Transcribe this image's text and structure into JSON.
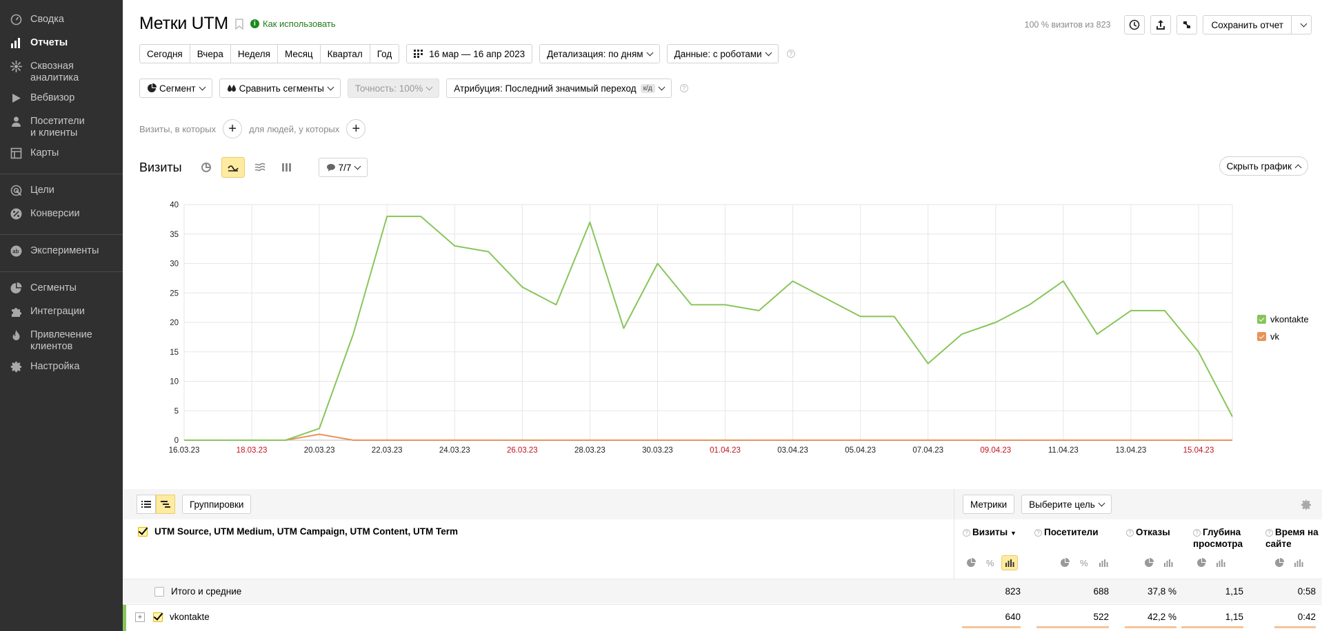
{
  "sidebar": {
    "items": [
      {
        "label": "Сводка",
        "icon": "dashboard-icon",
        "active": false
      },
      {
        "label": "Отчеты",
        "icon": "reports-icon",
        "active": true
      },
      {
        "label": "Сквозная\nаналитика",
        "icon": "crm-analytics-icon",
        "active": false
      },
      {
        "label": "Вебвизор",
        "icon": "play-icon",
        "active": false
      },
      {
        "label": "Посетители\nи клиенты",
        "icon": "person-icon",
        "active": false
      },
      {
        "label": "Карты",
        "icon": "maps-icon",
        "active": false
      },
      {
        "label": "Цели",
        "icon": "goals-icon",
        "active": false
      },
      {
        "label": "Конверсии",
        "icon": "percent-icon",
        "active": false
      },
      {
        "label": "Эксперименты",
        "icon": "ab-icon",
        "active": false
      },
      {
        "label": "Сегменты",
        "icon": "segments-icon",
        "active": false
      },
      {
        "label": "Интеграции",
        "icon": "puzzle-icon",
        "active": false
      },
      {
        "label": "Привлечение\nклиентов",
        "icon": "flame-icon",
        "active": false
      },
      {
        "label": "Настройка",
        "icon": "gear-icon",
        "active": false
      }
    ]
  },
  "header": {
    "title": "Метки UTM",
    "howto_label": "Как использовать",
    "visits_of": "100 % визитов из 823",
    "save_label": "Сохранить отчет"
  },
  "period": {
    "options": [
      "Сегодня",
      "Вчера",
      "Неделя",
      "Месяц",
      "Квартал",
      "Год"
    ],
    "date_range": "16 мар — 16 апр 2023",
    "detail": "Детализация: по дням",
    "data": "Данные: с роботами"
  },
  "filters": {
    "segment": "Сегмент",
    "compare": "Сравнить сегменты",
    "accuracy": "Точность: 100%",
    "attribution": "Атрибуция: Последний значимый переход",
    "attribution_badge": "к/д"
  },
  "conditions": {
    "visits_where": "Визиты, в которых",
    "people_where": "для людей, у которых"
  },
  "chart_head": {
    "title": "Визиты",
    "counter": "7/7",
    "hide_label": "Скрыть график"
  },
  "chart_data": {
    "type": "line",
    "x": [
      "16.03.23",
      "17.03.23",
      "18.03.23",
      "19.03.23",
      "20.03.23",
      "21.03.23",
      "22.03.23",
      "23.03.23",
      "24.03.23",
      "25.03.23",
      "26.03.23",
      "27.03.23",
      "28.03.23",
      "29.03.23",
      "30.03.23",
      "31.03.23",
      "01.04.23",
      "02.04.23",
      "03.04.23",
      "04.04.23",
      "05.04.23",
      "06.04.23",
      "07.04.23",
      "08.04.23",
      "09.04.23",
      "10.04.23",
      "11.04.23",
      "12.04.23",
      "13.04.23",
      "14.04.23",
      "15.04.23",
      "16.04.23"
    ],
    "tick_labels": [
      "16.03.23",
      "18.03.23",
      "20.03.23",
      "22.03.23",
      "24.03.23",
      "26.03.23",
      "28.03.23",
      "30.03.23",
      "01.04.23",
      "03.04.23",
      "05.04.23",
      "07.04.23",
      "09.04.23",
      "11.04.23",
      "13.04.23",
      "15.04.23"
    ],
    "weekend_ticks": [
      "18.03.23",
      "26.03.23",
      "01.04.23",
      "09.04.23",
      "15.04.23"
    ],
    "yticks": [
      0,
      5,
      10,
      15,
      20,
      25,
      30,
      35,
      40
    ],
    "ylim": [
      0,
      40
    ],
    "grid": true,
    "legend_position": "right",
    "series": [
      {
        "name": "vkontakte",
        "color": "#87c55a",
        "values": [
          0,
          0,
          0,
          0,
          2,
          18,
          38,
          38,
          33,
          32,
          26,
          23,
          37,
          19,
          30,
          23,
          23,
          22,
          27,
          24,
          21,
          21,
          13,
          18,
          20,
          23,
          27,
          18,
          22,
          22,
          15,
          4
        ]
      },
      {
        "name": "vk",
        "color": "#e8935a",
        "values": [
          0,
          0,
          0,
          0,
          1,
          0,
          0,
          0,
          0,
          0,
          0,
          0,
          0,
          0,
          0,
          0,
          0,
          0,
          0,
          0,
          0,
          0,
          0,
          0,
          0,
          0,
          0,
          0,
          0,
          0,
          0,
          0
        ]
      }
    ]
  },
  "table": {
    "groupings_label": "Группировки",
    "metrics_label": "Метрики",
    "goal_label": "Выберите цель",
    "dimension": "UTM Source, UTM Medium, UTM Campaign, UTM Content, UTM Term",
    "columns": [
      {
        "label": "Визиты",
        "sort": "▼"
      },
      {
        "label": "Посетители"
      },
      {
        "label": "Отказы"
      },
      {
        "label": "Глубина просмотра"
      },
      {
        "label": "Время на сайте"
      }
    ],
    "total": {
      "label": "Итого и средние",
      "values": [
        "823",
        "688",
        "37,8 %",
        "1,15",
        "0:58"
      ]
    },
    "rows": [
      {
        "label": "vkontakte",
        "values": [
          "640",
          "522",
          "42,2 %",
          "1,15",
          "0:42"
        ]
      }
    ]
  }
}
